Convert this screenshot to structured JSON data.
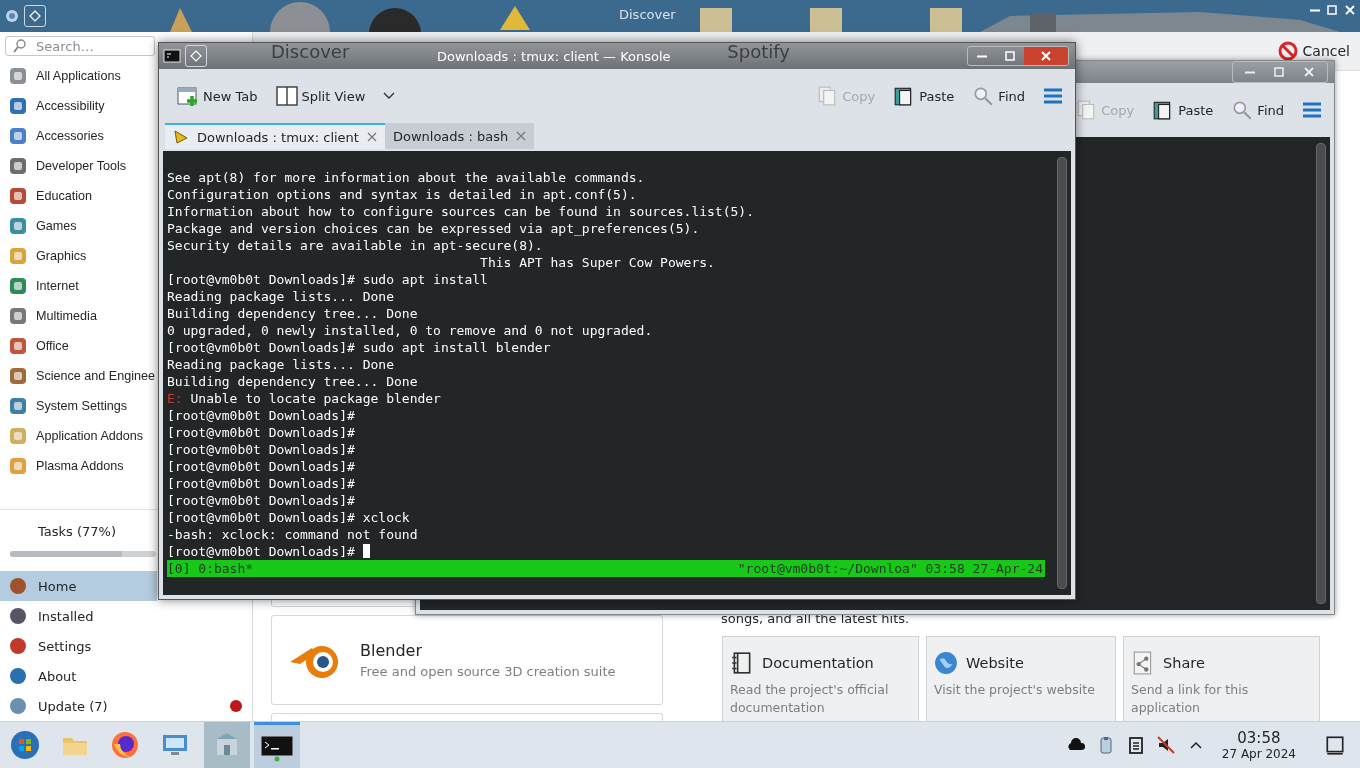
{
  "desktop": {
    "window_title": "Discover"
  },
  "discover": {
    "search": {
      "placeholder": "Search…"
    },
    "categories": [
      {
        "label": "All Applications"
      },
      {
        "label": "Accessibility"
      },
      {
        "label": "Accessories"
      },
      {
        "label": "Developer Tools"
      },
      {
        "label": "Education"
      },
      {
        "label": "Games"
      },
      {
        "label": "Graphics"
      },
      {
        "label": "Internet"
      },
      {
        "label": "Multimedia"
      },
      {
        "label": "Office"
      },
      {
        "label": "Science and Enginee"
      },
      {
        "label": "System Settings"
      },
      {
        "label": "Application Addons"
      },
      {
        "label": "Plasma Addons"
      }
    ],
    "tasks": {
      "label": "Tasks (77%)",
      "level": 0.77
    },
    "nav": [
      {
        "label": "Home",
        "selected": true,
        "alert": false
      },
      {
        "label": "Installed",
        "selected": false,
        "alert": false
      },
      {
        "label": "Settings",
        "selected": false,
        "alert": false
      },
      {
        "label": "About",
        "selected": false,
        "alert": false
      },
      {
        "label": "Update (7)",
        "selected": false,
        "alert": true
      }
    ],
    "header": {
      "title": "Discover",
      "app_title": "Spotify",
      "cancel": "Cancel"
    },
    "app_card": {
      "name": "Blender",
      "summary": "Free and open source 3D creation suite"
    },
    "description_tail": "songs, and all the latest hits.",
    "links": [
      {
        "kind": "docs",
        "title": "Documentation",
        "text": "Read the project's official documentation"
      },
      {
        "kind": "web",
        "title": "Website",
        "text": "Visit the project's website"
      },
      {
        "kind": "share",
        "title": "Share",
        "text": "Send a link for this application"
      }
    ]
  },
  "konsole_back": {
    "toolbar": [
      {
        "kind": "copy",
        "label": "Copy",
        "disabled": true
      },
      {
        "kind": "paste",
        "label": "Paste",
        "disabled": false
      },
      {
        "kind": "find",
        "label": "Find",
        "disabled": false
      }
    ]
  },
  "konsole": {
    "title": "Downloads : tmux: client — Konsole",
    "toolbar_left": [
      {
        "kind": "new-tab",
        "label": "New Tab"
      },
      {
        "kind": "split",
        "label": "Split View"
      }
    ],
    "toolbar_right": [
      {
        "kind": "copy",
        "label": "Copy",
        "disabled": true
      },
      {
        "kind": "paste",
        "label": "Paste",
        "disabled": false
      },
      {
        "kind": "find",
        "label": "Find",
        "disabled": false
      }
    ],
    "tabs": [
      {
        "label": "Downloads : tmux: client",
        "selected": true
      },
      {
        "label": "Downloads : bash",
        "selected": false
      }
    ],
    "lines": [
      {
        "kind": "out",
        "text": "See apt(8) for more information about the available commands."
      },
      {
        "kind": "out",
        "text": "Configuration options and syntax is detailed in apt.conf(5)."
      },
      {
        "kind": "out",
        "text": "Information about how to configure sources can be found in sources.list(5)."
      },
      {
        "kind": "out",
        "text": "Package and version choices can be expressed via apt_preferences(5)."
      },
      {
        "kind": "out",
        "text": "Security details are available in apt-secure(8)."
      },
      {
        "kind": "out",
        "text": "                                        This APT has Super Cow Powers."
      },
      {
        "kind": "out",
        "text": "[root@vm0b0t Downloads]# sudo apt install"
      },
      {
        "kind": "out",
        "text": "Reading package lists... Done"
      },
      {
        "kind": "out",
        "text": "Building dependency tree... Done"
      },
      {
        "kind": "out",
        "text": "0 upgraded, 0 newly installed, 0 to remove and 0 not upgraded."
      },
      {
        "kind": "out",
        "text": "[root@vm0b0t Downloads]# sudo apt install blender"
      },
      {
        "kind": "out",
        "text": "Reading package lists... Done"
      },
      {
        "kind": "out",
        "text": "Building dependency tree... Done"
      },
      {
        "kind": "error",
        "label": "E:",
        "text": " Unable to locate package blender"
      },
      {
        "kind": "out",
        "text": "[root@vm0b0t Downloads]#"
      },
      {
        "kind": "out",
        "text": "[root@vm0b0t Downloads]#"
      },
      {
        "kind": "out",
        "text": "[root@vm0b0t Downloads]#"
      },
      {
        "kind": "out",
        "text": "[root@vm0b0t Downloads]#"
      },
      {
        "kind": "out",
        "text": "[root@vm0b0t Downloads]#"
      },
      {
        "kind": "out",
        "text": "[root@vm0b0t Downloads]#"
      },
      {
        "kind": "out",
        "text": "[root@vm0b0t Downloads]# xclock"
      },
      {
        "kind": "out",
        "text": "-bash: xclock: command not found"
      },
      {
        "kind": "out",
        "text": "[root@vm0b0t Downloads]# "
      }
    ],
    "cursor": true,
    "status_left": "[0] 0:bash*",
    "status_right": "\"root@vm0b0t:~/Downloa\" 03:58 27-Apr-24"
  },
  "taskbar": {
    "time": "03:58",
    "date": "27 Apr 2024"
  }
}
